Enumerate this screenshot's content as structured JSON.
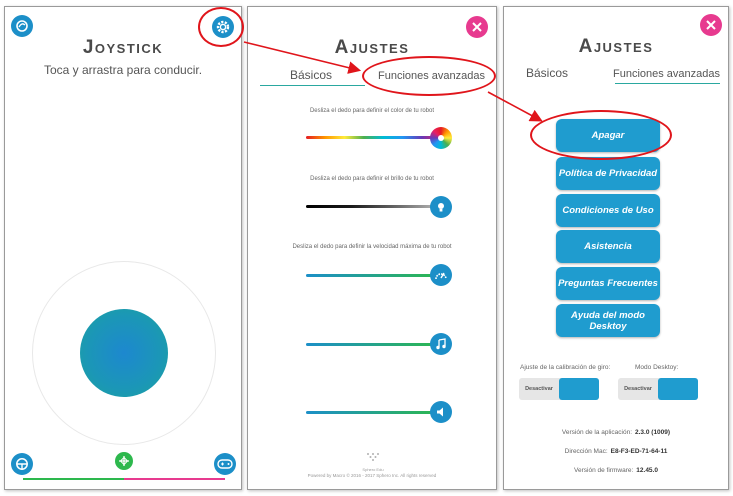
{
  "joystick": {
    "title": "Joystick",
    "subtitle": "Toca y arrastra para conducir."
  },
  "ajustes_basicos": {
    "title": "Ajustes",
    "tab_basicos": "Básicos",
    "tab_avanzadas": "Funciones avanzadas",
    "hint_color": "Desliza el dedo para definir el color de tu robot",
    "hint_brillo": "Desliza el dedo para definir el brillo de tu robot",
    "hint_velocidad": "Desliza el dedo para definir la velocidad máxima de tu robot",
    "footer_logo": "Sphero Edu",
    "footer": "Powered by Macro © 2016 - 2017 Sphero Inc. All rights reserved"
  },
  "ajustes_avanzadas": {
    "title": "Ajustes",
    "tab_basicos": "Básicos",
    "tab_avanzadas": "Funciones avanzadas",
    "buttons": [
      "Apagar",
      "Política de Privacidad",
      "Condiciones de Uso",
      "Asistencia",
      "Preguntas Frecuentes",
      "Ayuda del modo Desktoy"
    ],
    "calibracion_label": "Ajuste de la calibración de giro:",
    "desktoy_label": "Modo Desktoy:",
    "toggle_off": "Desactivar",
    "version_label": "Versión de la aplicación:",
    "version_value": "2.3.0 (1009)",
    "mac_label": "Dirección Mac:",
    "mac_value": "E8-F3-ED-71-64-11",
    "firmware_label": "Versión de firmware:",
    "firmware_value": "12.45.0"
  },
  "colors": {
    "accent_blue": "#1c8fc8",
    "close_pink": "#e73a8f",
    "annotation_red": "#e0151b",
    "green": "#2db84d"
  }
}
